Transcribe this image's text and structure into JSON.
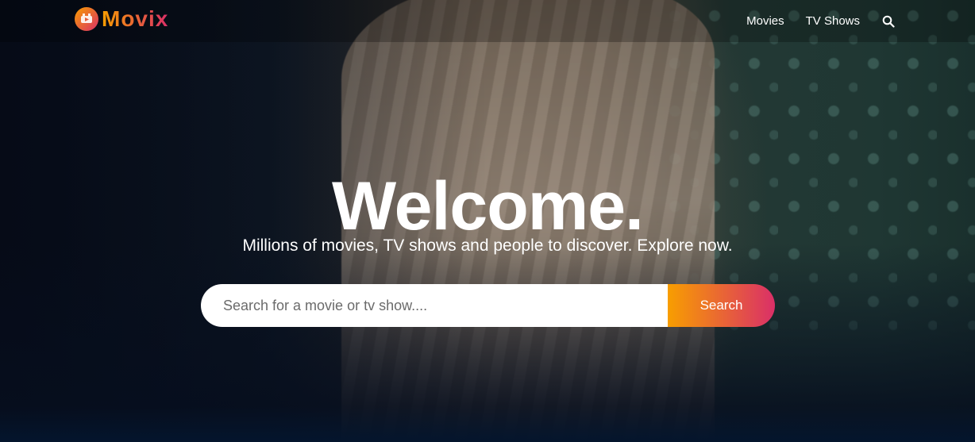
{
  "brand": {
    "name": "Movix",
    "gradient_start": "#f89e00",
    "gradient_end": "#da2f68",
    "logo_icon": "film-reel-icon"
  },
  "nav": {
    "items": [
      {
        "label": "Movies"
      },
      {
        "label": "TV Shows"
      }
    ],
    "search_icon": "search-icon"
  },
  "hero": {
    "title": "Welcome.",
    "subtitle": "Millions of movies, TV shows and people to discover. Explore now.",
    "search": {
      "placeholder": "Search for a movie or tv show....",
      "value": "",
      "button_label": "Search"
    }
  },
  "colors": {
    "background_bottom": "#04152d",
    "text": "#ffffff"
  }
}
